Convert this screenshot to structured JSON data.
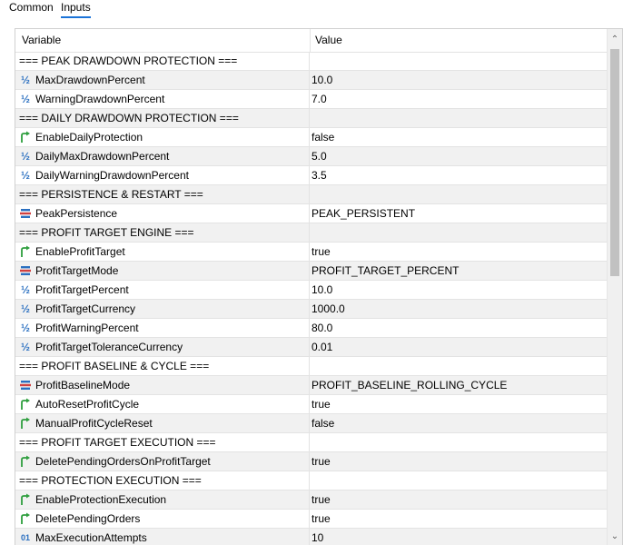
{
  "tabs": [
    "Common",
    "Inputs"
  ],
  "columns": [
    "Variable",
    "Value"
  ],
  "icons": {
    "half": "½",
    "arrow_color": "#2e9e3e",
    "enum_color": "#2a6fc0"
  },
  "rows": [
    {
      "kind": "section",
      "name": "=== PEAK DRAWDOWN PROTECTION ===",
      "value": ""
    },
    {
      "kind": "param",
      "icon": "half",
      "name": "MaxDrawdownPercent",
      "value": "10.0"
    },
    {
      "kind": "param",
      "icon": "half",
      "name": "WarningDrawdownPercent",
      "value": "7.0"
    },
    {
      "kind": "section",
      "name": "=== DAILY DRAWDOWN PROTECTION ===",
      "value": ""
    },
    {
      "kind": "param",
      "icon": "bool",
      "name": "EnableDailyProtection",
      "value": "false"
    },
    {
      "kind": "param",
      "icon": "half",
      "name": "DailyMaxDrawdownPercent",
      "value": "5.0"
    },
    {
      "kind": "param",
      "icon": "half",
      "name": "DailyWarningDrawdownPercent",
      "value": "3.5"
    },
    {
      "kind": "section",
      "name": "=== PERSISTENCE & RESTART ===",
      "value": ""
    },
    {
      "kind": "param",
      "icon": "enum",
      "name": "PeakPersistence",
      "value": "PEAK_PERSISTENT"
    },
    {
      "kind": "section",
      "name": "=== PROFIT TARGET ENGINE ===",
      "value": ""
    },
    {
      "kind": "param",
      "icon": "bool",
      "name": "EnableProfitTarget",
      "value": "true"
    },
    {
      "kind": "param",
      "icon": "enum",
      "name": "ProfitTargetMode",
      "value": "PROFIT_TARGET_PERCENT"
    },
    {
      "kind": "param",
      "icon": "half",
      "name": "ProfitTargetPercent",
      "value": "10.0"
    },
    {
      "kind": "param",
      "icon": "half",
      "name": "ProfitTargetCurrency",
      "value": "1000.0"
    },
    {
      "kind": "param",
      "icon": "half",
      "name": "ProfitWarningPercent",
      "value": "80.0"
    },
    {
      "kind": "param",
      "icon": "half",
      "name": "ProfitTargetToleranceCurrency",
      "value": "0.01"
    },
    {
      "kind": "section",
      "name": "=== PROFIT BASELINE & CYCLE ===",
      "value": ""
    },
    {
      "kind": "param",
      "icon": "enum",
      "name": "ProfitBaselineMode",
      "value": "PROFIT_BASELINE_ROLLING_CYCLE"
    },
    {
      "kind": "param",
      "icon": "bool",
      "name": "AutoResetProfitCycle",
      "value": "true"
    },
    {
      "kind": "param",
      "icon": "bool",
      "name": "ManualProfitCycleReset",
      "value": "false"
    },
    {
      "kind": "section",
      "name": "=== PROFIT TARGET EXECUTION ===",
      "value": ""
    },
    {
      "kind": "param",
      "icon": "bool",
      "name": "DeletePendingOrdersOnProfitTarget",
      "value": "true"
    },
    {
      "kind": "section",
      "name": "=== PROTECTION EXECUTION ===",
      "value": ""
    },
    {
      "kind": "param",
      "icon": "bool",
      "name": "EnableProtectionExecution",
      "value": "true"
    },
    {
      "kind": "param",
      "icon": "bool",
      "name": "DeletePendingOrders",
      "value": "true"
    },
    {
      "kind": "param",
      "icon": "int",
      "name": "MaxExecutionAttempts",
      "value": "10"
    }
  ]
}
